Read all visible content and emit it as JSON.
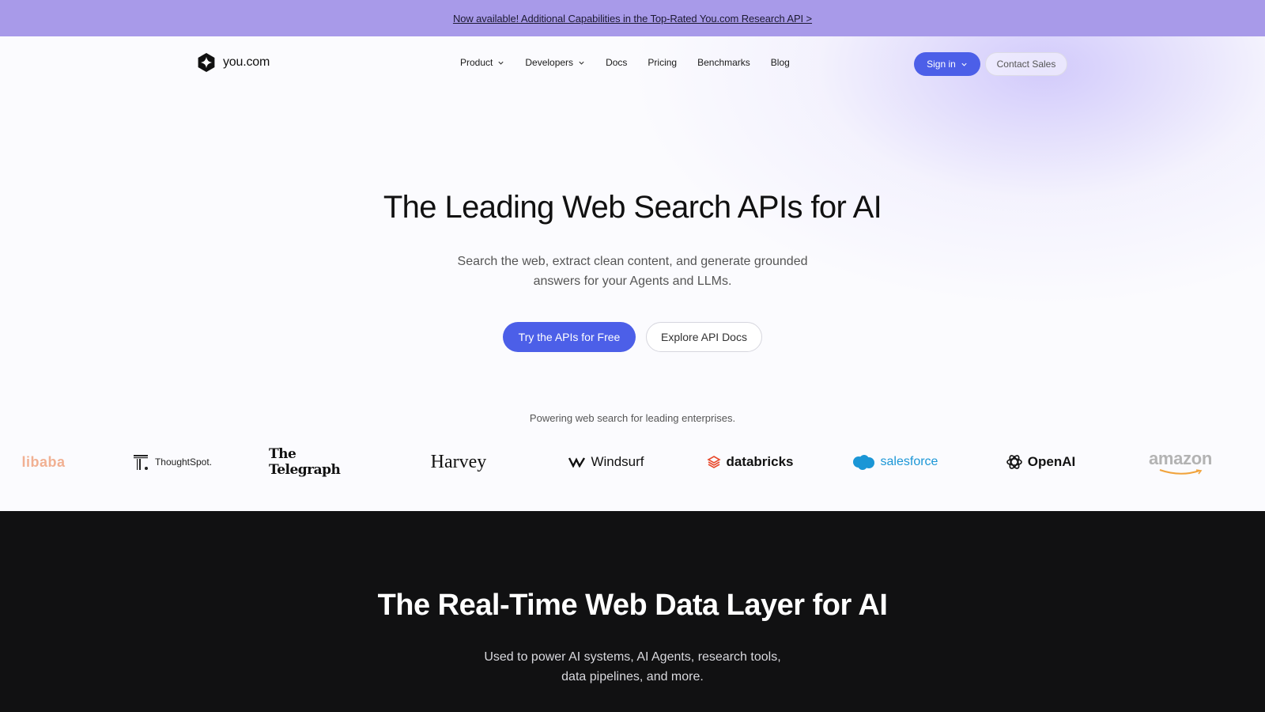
{
  "announcement": {
    "text": "Now available! Additional Capabilities in the Top-Rated You.com Research API >"
  },
  "nav": {
    "brand": "you.com",
    "links": [
      {
        "label": "Product",
        "dropdown": true
      },
      {
        "label": "Developers",
        "dropdown": true
      },
      {
        "label": "Docs",
        "dropdown": false
      },
      {
        "label": "Pricing",
        "dropdown": false
      },
      {
        "label": "Benchmarks",
        "dropdown": false
      },
      {
        "label": "Blog",
        "dropdown": false
      }
    ],
    "signin_label": "Sign in",
    "contact_label": "Contact Sales"
  },
  "hero": {
    "title": "The Leading Web Search APIs for AI",
    "subtitle_line1": "Search the web, extract clean content, and generate grounded",
    "subtitle_line2": "answers for your Agents and LLMs.",
    "primary_cta": "Try the APIs for Free",
    "secondary_cta": "Explore API Docs"
  },
  "customers": {
    "heading": "Powering web search for leading enterprises.",
    "logos": {
      "alibaba": "libaba",
      "thoughtspot": "ThoughtSpot.",
      "telegraph": "The Telegraph",
      "harvey": "Harvey",
      "windsurf": "Windsurf",
      "databricks": "databricks",
      "salesforce": "salesforce",
      "openai": "OpenAI",
      "amazon": "amazon"
    }
  },
  "data_layer": {
    "title": "The Real-Time Web Data Layer for AI",
    "subtitle_line1": "Used to power AI systems, AI Agents, research tools,",
    "subtitle_line2": "data pipelines, and more."
  },
  "colors": {
    "announcement_bg": "#a89ae9",
    "accent": "#4c5fe8",
    "dark_section_bg": "#111112"
  },
  "icons": {
    "brand": "you-logo-icon",
    "dropdown": "chevron-down-icon"
  }
}
